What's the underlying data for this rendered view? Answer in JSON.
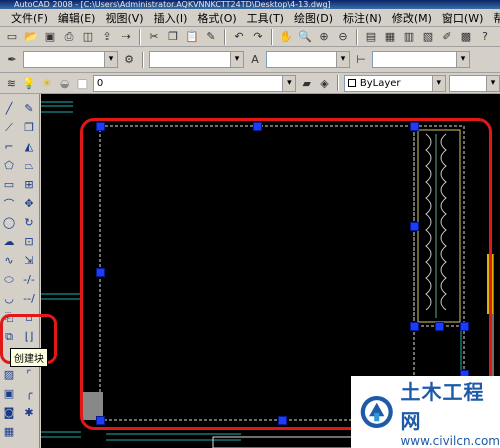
{
  "window": {
    "title": "AutoCAD 2008 - [C:\\Users\\Administrator.AQKVNNKCTT24TD\\Desktop\\4-13.dwg]"
  },
  "menu": {
    "items": [
      "文件(F)",
      "编辑(E)",
      "视图(V)",
      "插入(I)",
      "格式(O)",
      "工具(T)",
      "绘图(D)",
      "标注(N)",
      "修改(M)",
      "窗口(W)",
      "帮"
    ]
  },
  "toolbar2": {
    "layer_value": "0"
  },
  "toolbar3": {
    "color_value": "ByLayer"
  },
  "tooltip": {
    "text": "创建块"
  },
  "watermark": {
    "title": "土木工程网",
    "url": "www.civilcn.com"
  },
  "colors": {
    "highlight_red": "#e01818",
    "grip_blue": "#1a3cff",
    "canvas_bg": "#000000"
  }
}
